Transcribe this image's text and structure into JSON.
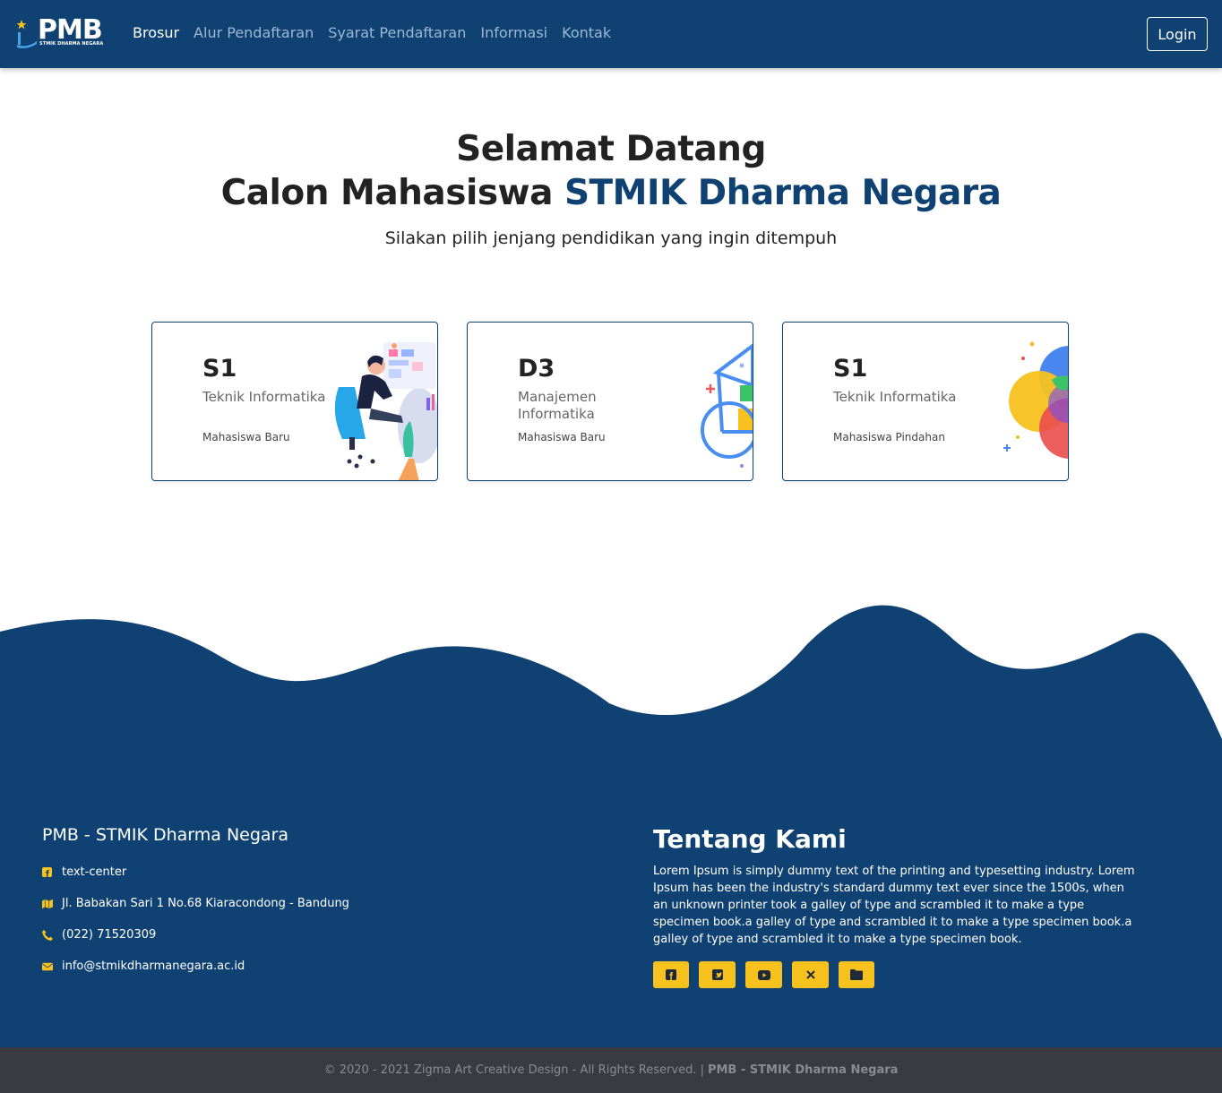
{
  "nav": {
    "logo_text": "PMB",
    "logo_sub": "STMIK DHARMA NEGARA",
    "items": [
      {
        "label": "Brosur",
        "active": true
      },
      {
        "label": "Alur Pendaftaran",
        "active": false
      },
      {
        "label": "Syarat Pendaftaran",
        "active": false
      },
      {
        "label": "Informasi",
        "active": false
      },
      {
        "label": "Kontak",
        "active": false
      }
    ],
    "login": "Login"
  },
  "hero": {
    "line1": "Selamat Datang",
    "line2_prefix": "Calon Mahasiswa ",
    "line2_accent": "STMIK Dharma Negara",
    "subtitle": "Silakan pilih jenjang pendidikan yang ingin ditempuh"
  },
  "cards": [
    {
      "level": "S1",
      "program": "Teknik Informatika",
      "type": "Mahasiswa Baru",
      "art": "person-computer"
    },
    {
      "level": "D3",
      "program": "Manajemen Informatika",
      "type": "Mahasiswa Baru",
      "art": "geometric-shapes"
    },
    {
      "level": "S1",
      "program": "Teknik Informatika",
      "type": "Mahasiswa Pindahan",
      "art": "color-circles"
    }
  ],
  "footer": {
    "title": "PMB - STMIK Dharma Negara",
    "contacts": [
      {
        "icon": "facebook-square-icon",
        "text": "text-center"
      },
      {
        "icon": "map-icon",
        "text": "Jl. Babakan Sari 1 No.68 Kiaracondong - Bandung"
      },
      {
        "icon": "phone-icon",
        "text": "(022) 71520309"
      },
      {
        "icon": "envelope-icon",
        "text": "info@stmikdharmanegara.ac.id"
      }
    ],
    "about_title": "Tentang Kami",
    "about_text": "Lorem Ipsum is simply dummy text of the printing and typesetting industry. Lorem Ipsum has been the industry's standard dummy text ever since the 1500s, when an unknown printer took a galley of type and scrambled it to make a type specimen book.a galley of type and scrambled it to make a type specimen book.a galley of type and scrambled it to make a type specimen book.",
    "socials": [
      "facebook-icon",
      "twitter-icon",
      "youtube-icon",
      "x-icon",
      "folder-icon"
    ],
    "copyright": "© 2020 - 2021 Zigma Art Creative Design - All Rights Reserved. |",
    "copyright_brand": "PMB - STMIK Dharma Negara"
  },
  "colors": {
    "primary": "#0f4273",
    "accent": "#f7c21e",
    "bottom_bar": "#3a3b40"
  }
}
